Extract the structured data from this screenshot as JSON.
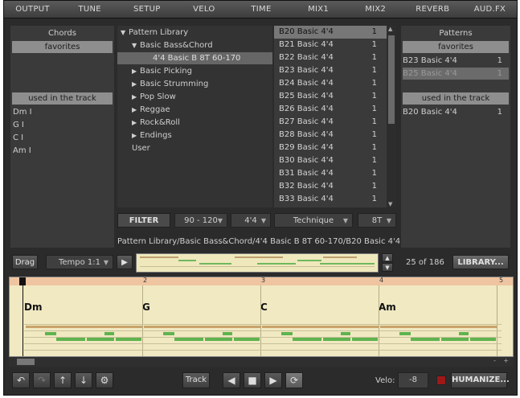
{
  "nav": {
    "tabs": [
      "OUTPUT",
      "TUNE",
      "SETUP",
      "VELO",
      "TIME",
      "MIX1",
      "MIX2",
      "REVERB",
      "AUD.FX"
    ]
  },
  "chords": {
    "title": "Chords",
    "favorites_label": "favorites",
    "used_label": "used in the track",
    "used_items": [
      "Dm I",
      "G I",
      "C I",
      "Am I"
    ]
  },
  "library": {
    "root": "Pattern Library",
    "open_folder": "Basic Bass&Chord",
    "open_subfolder": "4'4 Basic B 8T 60-170",
    "folders": [
      "Basic Picking",
      "Basic Strumming",
      "Pop Slow",
      "Reggae",
      "Rock&Roll",
      "Endings"
    ],
    "user": "User"
  },
  "patterns_list": [
    {
      "name": "B20 Basic 4'4",
      "count": "1"
    },
    {
      "name": "B21 Basic 4'4",
      "count": "1"
    },
    {
      "name": "B22 Basic 4'4",
      "count": "1"
    },
    {
      "name": "B23 Basic 4'4",
      "count": "1"
    },
    {
      "name": "B24 Basic 4'4",
      "count": "1"
    },
    {
      "name": "B25 Basic 4'4",
      "count": "1"
    },
    {
      "name": "B26 Basic 4'4",
      "count": "1"
    },
    {
      "name": "B27 Basic 4'4",
      "count": "1"
    },
    {
      "name": "B28 Basic 4'4",
      "count": "1"
    },
    {
      "name": "B29 Basic 4'4",
      "count": "1"
    },
    {
      "name": "B30 Basic 4'4",
      "count": "1"
    },
    {
      "name": "B31 Basic 4'4",
      "count": "1"
    },
    {
      "name": "B32 Basic 4'4",
      "count": "1"
    },
    {
      "name": "B33 Basic 4'4",
      "count": "1"
    }
  ],
  "patterns": {
    "title": "Patterns",
    "favorites_label": "favorites",
    "favorites": [
      {
        "name": "B23 Basic 4'4",
        "count": "1"
      },
      {
        "name": "B25 Basic 4'4",
        "count": "1"
      }
    ],
    "used_label": "used in the track",
    "used": [
      {
        "name": "B20 Basic 4'4",
        "count": "1"
      }
    ]
  },
  "filter": {
    "button": "FILTER",
    "tempo_range": "90 - 120",
    "signature": "4'4",
    "technique": "Technique",
    "feel": "8T"
  },
  "path": "Pattern Library/Basic Bass&Chord/4'4 Basic B 8T 60-170/B20 Basic 4'4",
  "preview": {
    "drag_label": "Drag",
    "tempo_label": "Tempo 1:1",
    "play_icon": "play-icon",
    "counter": "25 of 186",
    "library_button": "LIBRARY..."
  },
  "timeline": {
    "bars": [
      "1",
      "2",
      "3",
      "4",
      "5"
    ],
    "chords": [
      "Dm",
      "G",
      "C",
      "Am"
    ]
  },
  "transport": {
    "track_label": "Track",
    "velo_label": "Velo:",
    "velo_value": "-8",
    "humanize_label": "HUMANIZE..."
  }
}
